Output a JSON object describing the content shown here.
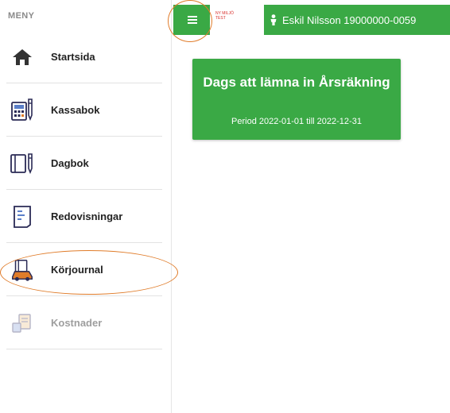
{
  "sidebar": {
    "heading": "MENY",
    "items": [
      {
        "label": "Startsida",
        "icon": "home-icon",
        "enabled": true
      },
      {
        "label": "Kassabok",
        "icon": "calculator-pen-icon",
        "enabled": true
      },
      {
        "label": "Dagbok",
        "icon": "notebook-pen-icon",
        "enabled": true
      },
      {
        "label": "Redovisningar",
        "icon": "document-list-icon",
        "enabled": true
      },
      {
        "label": "Körjournal",
        "icon": "car-book-icon",
        "enabled": true
      },
      {
        "label": "Kostnader",
        "icon": "receipt-icon",
        "enabled": false
      }
    ]
  },
  "topbar": {
    "brand_line1": "NY MILJÖ",
    "brand_line2": "TEST",
    "user_text": "Eskil Nilsson 19000000-0059",
    "menu_icon": "hamburger-icon",
    "user_icon": "person-icon"
  },
  "card": {
    "title": "Dags att lämna in Årsräkning",
    "subtitle": "Period 2022-01-01 till 2022-12-31"
  },
  "colors": {
    "primary_green": "#3aa945",
    "annotation_orange": "#e07c2a",
    "brand_red": "#d9302c"
  }
}
